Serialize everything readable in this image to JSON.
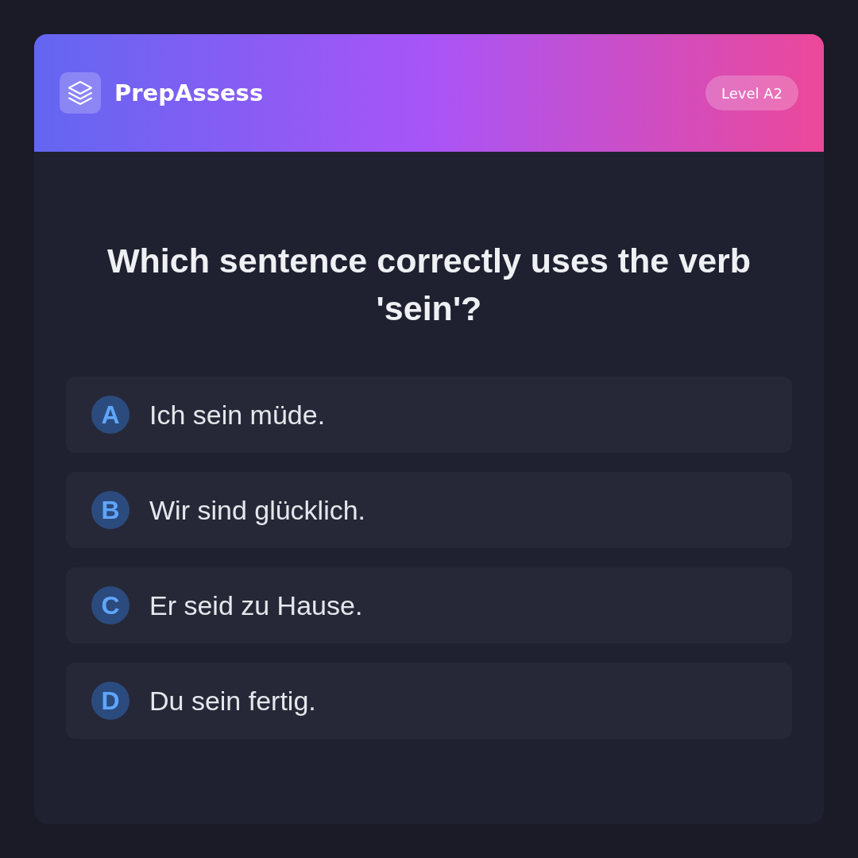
{
  "header": {
    "app_name": "PrepAssess",
    "level_badge": "Level A2"
  },
  "question": "Which sentence correctly uses the verb 'sein'?",
  "options": [
    {
      "letter": "A",
      "text": "Ich sein müde.",
      "selected": false
    },
    {
      "letter": "B",
      "text": "Wir sind glücklich.",
      "selected": false
    },
    {
      "letter": "C",
      "text": "Er seid zu Hause.",
      "selected": false
    },
    {
      "letter": "D",
      "text": "Du sein fertig.",
      "selected": false
    }
  ]
}
